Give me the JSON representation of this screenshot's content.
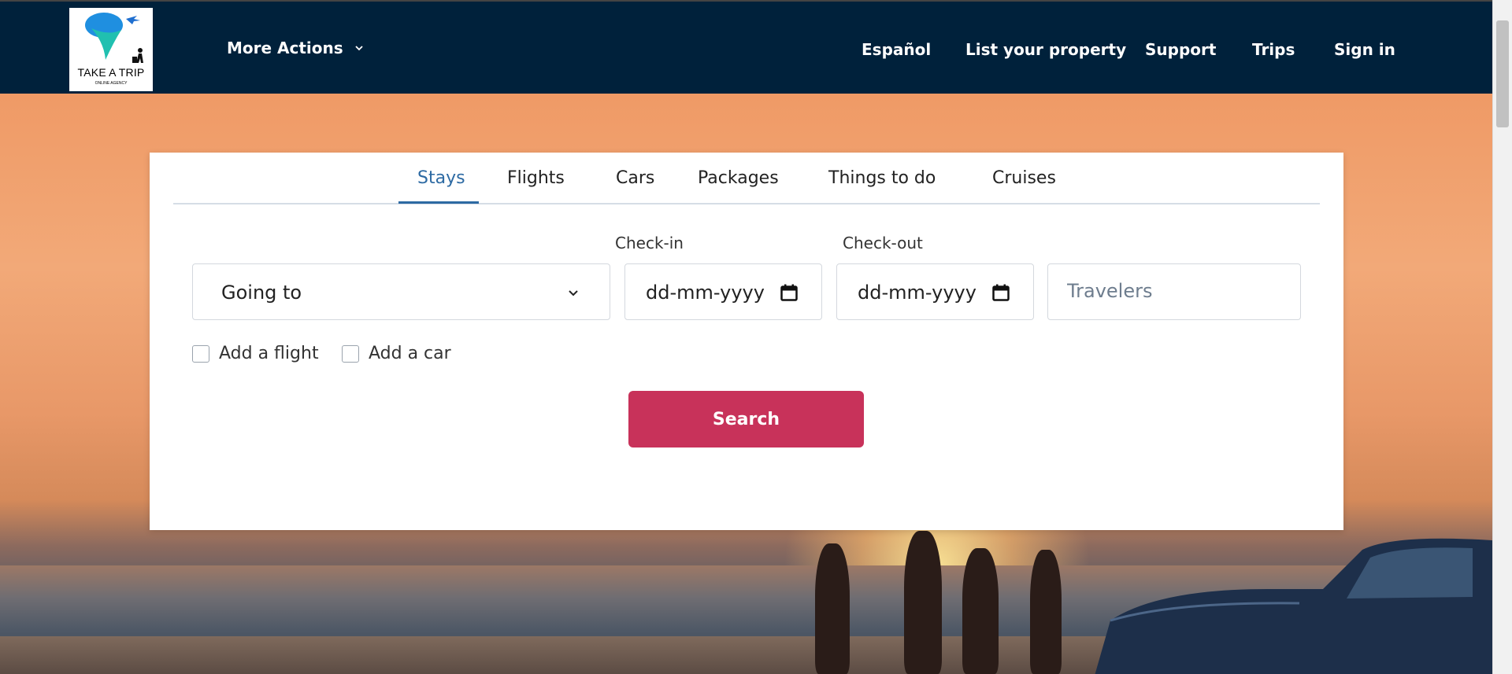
{
  "brand": {
    "logo_text": "TAKE A TRIP",
    "logo_subtext": "ONLINE AGENCY"
  },
  "nav": {
    "more_actions": "More Actions",
    "links": [
      "Español",
      "List your property",
      "Support",
      "Trips",
      "Sign in"
    ]
  },
  "search": {
    "tabs": [
      "Stays",
      "Flights",
      "Cars",
      "Packages",
      "Things to do",
      "Cruises"
    ],
    "active_tab": "Stays",
    "destination": {
      "value": "Going to"
    },
    "checkin": {
      "label": "Check-in",
      "value": "dd-mm-yyyy"
    },
    "checkout": {
      "label": "Check-out",
      "value": "dd-mm-yyyy"
    },
    "travelers": {
      "placeholder": "Travelers",
      "value": ""
    },
    "options": [
      "Add a flight",
      "Add a car"
    ],
    "submit_label": "Search"
  },
  "colors": {
    "nav_bg": "#00213b",
    "accent": "#2d6aa3",
    "button": "#c8325a"
  }
}
